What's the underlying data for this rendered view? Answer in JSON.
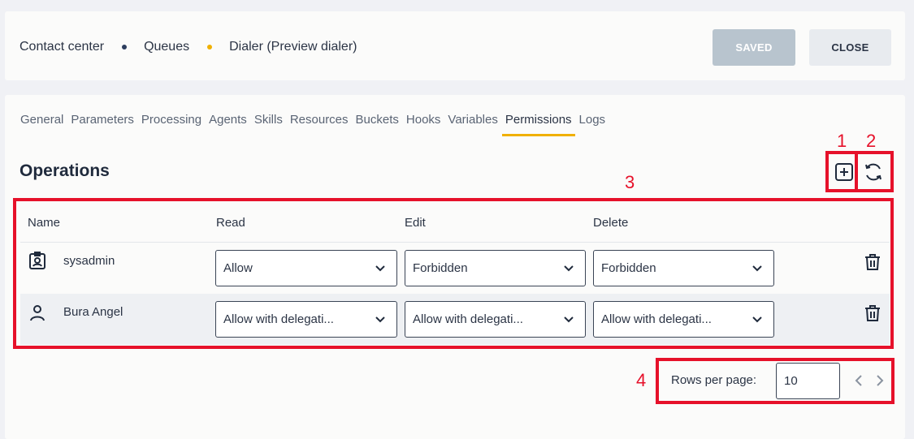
{
  "breadcrumb": {
    "items": [
      "Contact center",
      "Queues",
      "Dialer (Preview dialer)"
    ],
    "dot_colors": [
      "#2c3d5e",
      "#f0b000"
    ]
  },
  "header": {
    "saved_label": "SAVED",
    "close_label": "CLOSE"
  },
  "tabs": [
    {
      "label": "General",
      "active": false
    },
    {
      "label": "Parameters",
      "active": false
    },
    {
      "label": "Processing",
      "active": false
    },
    {
      "label": "Agents",
      "active": false
    },
    {
      "label": "Skills",
      "active": false
    },
    {
      "label": "Resources",
      "active": false
    },
    {
      "label": "Buckets",
      "active": false
    },
    {
      "label": "Hooks",
      "active": false
    },
    {
      "label": "Variables",
      "active": false
    },
    {
      "label": "Permissions",
      "active": true
    },
    {
      "label": "Logs",
      "active": false
    }
  ],
  "section": {
    "title": "Operations"
  },
  "annotations": [
    "1",
    "2",
    "3",
    "4"
  ],
  "table": {
    "columns": [
      "Name",
      "Read",
      "Edit",
      "Delete"
    ],
    "rows": [
      {
        "icon": "badge-icon",
        "name": "sysadmin",
        "read": "Allow",
        "edit": "Forbidden",
        "delete": "Forbidden"
      },
      {
        "icon": "user-icon",
        "name": "Bura Angel",
        "read": "Allow with delegati...",
        "edit": "Allow with delegati...",
        "delete": "Allow with delegati..."
      }
    ]
  },
  "pagination": {
    "rows_per_page_label": "Rows per page:",
    "rows_per_page_value": "10"
  },
  "colors": {
    "accent": "#f0b000",
    "annotation_red": "#e6112a",
    "saved_button": "#b8c4ce"
  }
}
